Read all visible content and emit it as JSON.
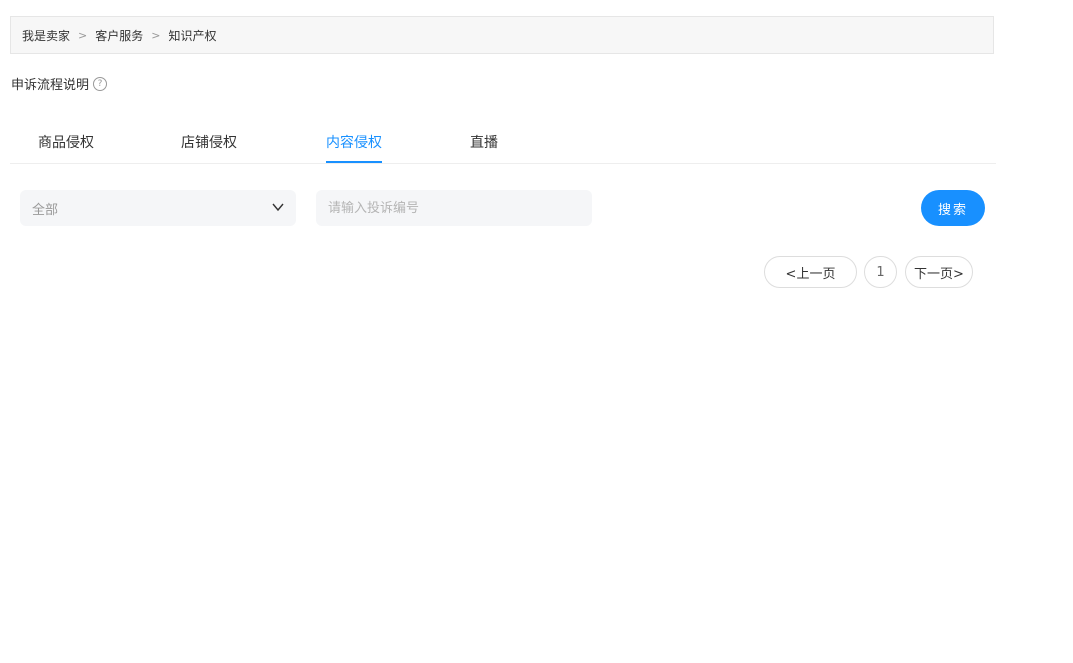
{
  "breadcrumb": {
    "items": [
      "我是卖家",
      "客户服务",
      "知识产权"
    ],
    "separator": ">"
  },
  "appeal": {
    "label": "申诉流程说明",
    "help_icon": "question-circle-icon",
    "help_glyph": "?"
  },
  "tabs": [
    {
      "label": "商品侵权",
      "active": false
    },
    {
      "label": "店铺侵权",
      "active": false
    },
    {
      "label": "内容侵权",
      "active": true
    },
    {
      "label": "直播",
      "active": false
    }
  ],
  "filter": {
    "select_value": "全部",
    "select_icon": "chevron-down-icon",
    "search_placeholder": "请输入投诉编号",
    "search_value": "",
    "search_button": "搜索"
  },
  "pagination": {
    "prev_label": "<上一页",
    "current_page": "1",
    "next_label": "下一页>"
  },
  "colors": {
    "accent": "#1890ff",
    "breadcrumb_bg": "#f7f7f7",
    "input_bg": "#f5f6f8"
  }
}
